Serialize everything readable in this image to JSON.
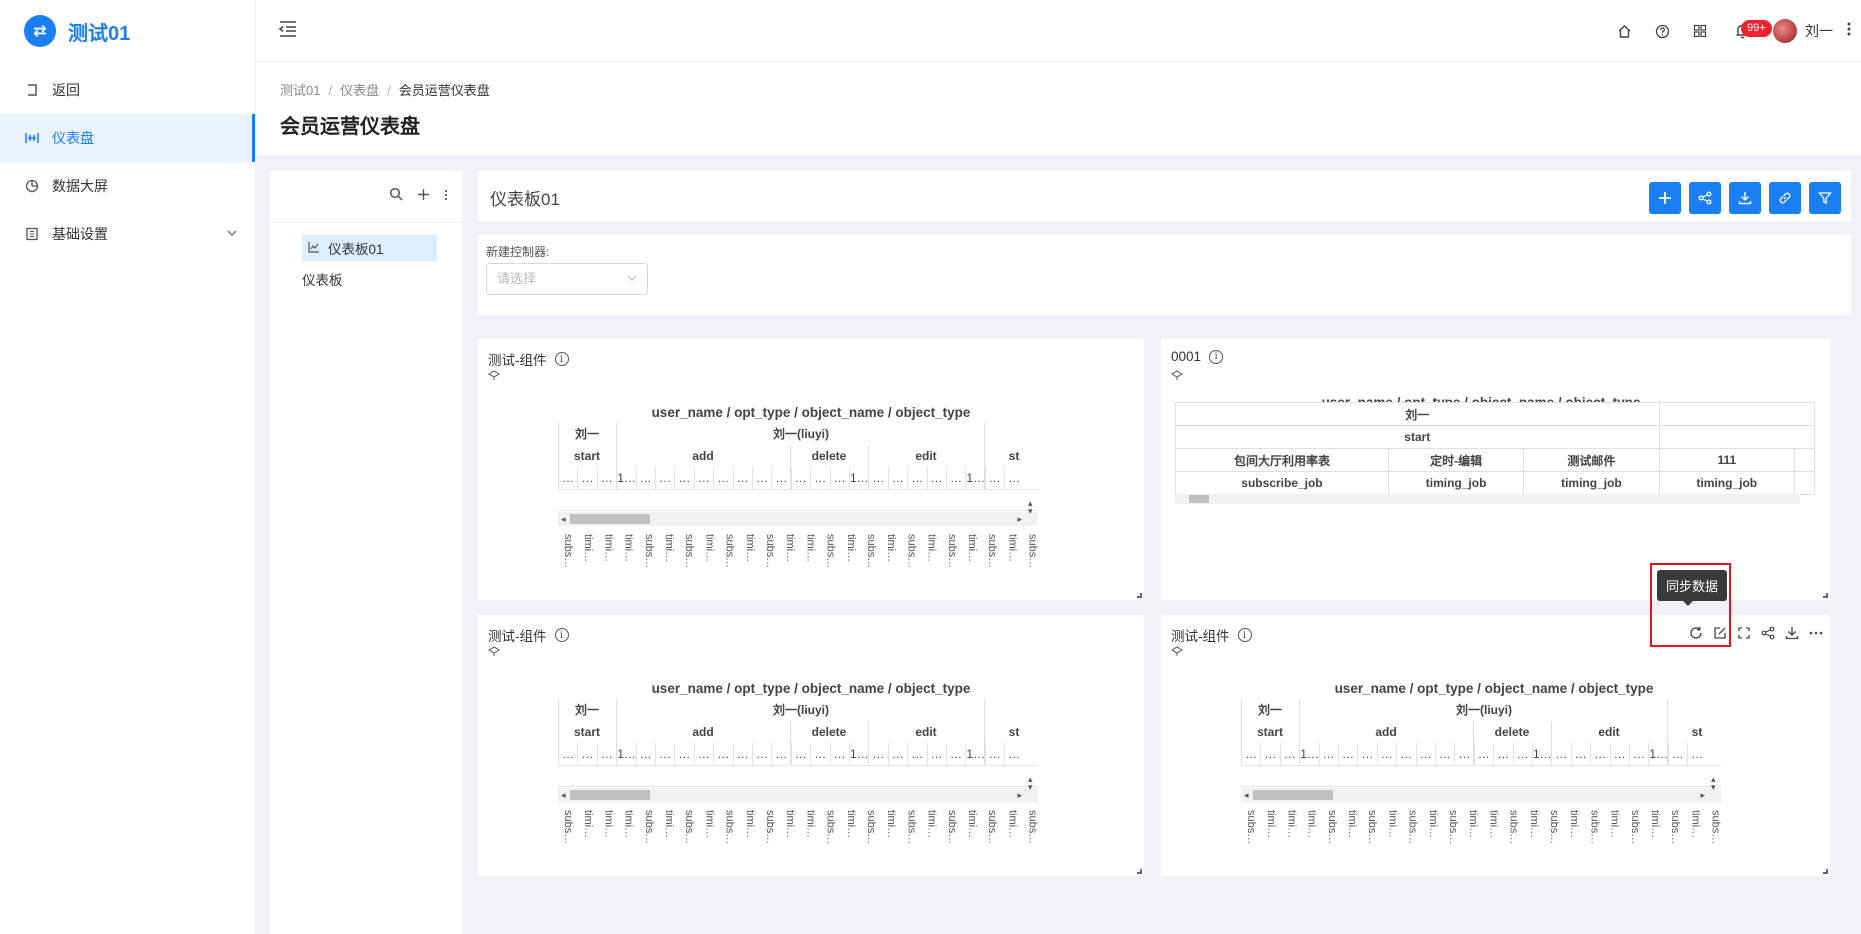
{
  "app": {
    "title": "测试01",
    "logo_glyph": "⇄"
  },
  "sidebar": {
    "items": [
      {
        "label": "返回",
        "icon": "back-icon"
      },
      {
        "label": "仪表盘",
        "icon": "dashboard-icon",
        "active": true
      },
      {
        "label": "数据大屏",
        "icon": "pie-icon"
      },
      {
        "label": "基础设置",
        "icon": "book-icon",
        "expandable": true
      }
    ]
  },
  "header": {
    "notification_badge": "99+",
    "user_name": "刘一"
  },
  "breadcrumb": [
    "测试01",
    "仪表盘",
    "会员运营仪表盘"
  ],
  "page_title": "会员运营仪表盘",
  "tree": {
    "items": [
      {
        "label": "仪表板01",
        "selected": true
      },
      {
        "label": "仪表板"
      }
    ]
  },
  "dashboard": {
    "title": "仪表板01",
    "controller_label": "新建控制器:",
    "controller_placeholder": "请选择"
  },
  "widgets": [
    {
      "title": "测试-组件",
      "pivot_title": "user_name / opt_type / object_name / object_type"
    },
    {
      "title": "0001",
      "pivot_title": "user_name / opt_type / object_name / object_type"
    },
    {
      "title": "测试-组件",
      "pivot_title": "user_name / opt_type / object_name / object_type"
    },
    {
      "title": "测试-组件",
      "pivot_title": "user_name / opt_type / object_name / object_type"
    }
  ],
  "pivot": {
    "row1": [
      "刘一",
      "刘一(liuyi)"
    ],
    "row2": [
      "start",
      "add",
      "delete",
      "edit",
      "st"
    ],
    "row3_cells": [
      "…",
      "…",
      "…",
      "1…",
      "…",
      "…",
      "…",
      "…",
      "…",
      "…",
      "…",
      "…",
      "…",
      "…",
      "…",
      "1…",
      "…",
      "…",
      "…",
      "…",
      "…",
      "1…",
      "…",
      "…"
    ],
    "vertical_labels": [
      "subs…",
      "timi…",
      "timi…",
      "timi…",
      "subs…",
      "timi…",
      "subs…",
      "timi…",
      "subs…",
      "timi…",
      "subs…",
      "timi…",
      "timi…",
      "subs…",
      "timi…",
      "subs…",
      "timi…",
      "subs…",
      "timi…",
      "subs…",
      "timi…",
      "subs…",
      "timi…",
      "subs…"
    ]
  },
  "table_0001": {
    "title": "user_name / opt_type / object_name / object_type",
    "row1": [
      "刘一",
      ""
    ],
    "row2": [
      "start",
      ""
    ],
    "row3": [
      "包间大厅利用率表",
      "定时-编辑",
      "测试邮件",
      "111"
    ],
    "row4": [
      "subscribe_job",
      "timing_job",
      "timing_job",
      "timing_job"
    ]
  },
  "tooltip": "同步数据"
}
